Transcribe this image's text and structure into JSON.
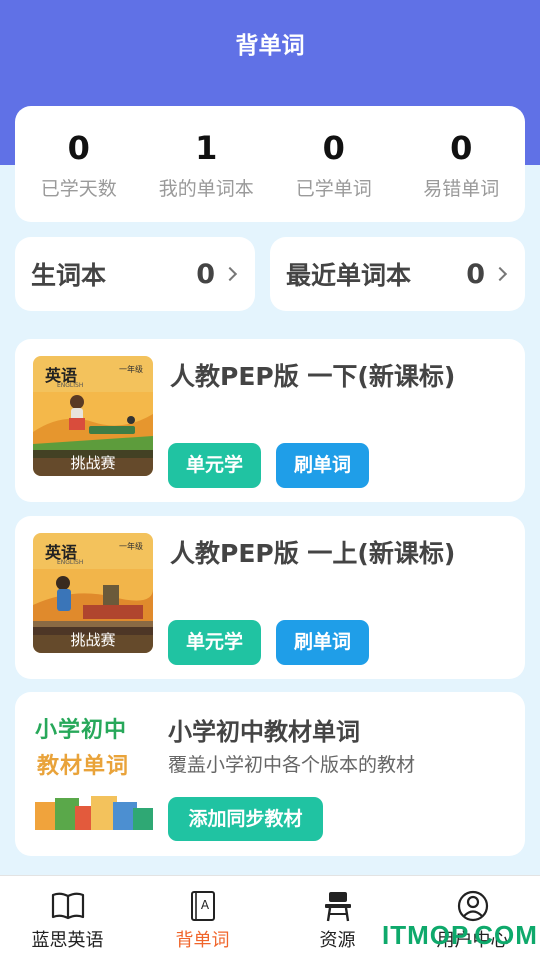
{
  "header": {
    "title": "背单词"
  },
  "stats": [
    {
      "value": "0",
      "label": "已学天数"
    },
    {
      "value": "1",
      "label": "我的单词本"
    },
    {
      "value": "0",
      "label": "已学单词"
    },
    {
      "value": "0",
      "label": "易错单词"
    }
  ],
  "quick": {
    "new_words": {
      "title": "生词本",
      "count": "0"
    },
    "recent": {
      "title": "最近单词本",
      "count": "0"
    }
  },
  "books": [
    {
      "title": "人教PEP版 一下(新课标)",
      "cover_title": "英语",
      "cover_sub": "ENGLISH",
      "cover_grade": "一年级",
      "badge": "挑战赛",
      "unit_btn": "单元学",
      "brush_btn": "刷单词"
    },
    {
      "title": "人教PEP版 一上(新课标)",
      "cover_title": "英语",
      "cover_sub": "ENGLISH",
      "cover_grade": "一年级",
      "badge": "挑战赛",
      "unit_btn": "单元学",
      "brush_btn": "刷单词"
    }
  ],
  "sync": {
    "cover_line1": "小学初中",
    "cover_line2": "教材单词",
    "title": "小学初中教材单词",
    "desc": "覆盖小学初中各个版本的教材",
    "button": "添加同步教材"
  },
  "tabs": [
    {
      "label": "蓝思英语",
      "icon": "book-open-icon"
    },
    {
      "label": "背单词",
      "icon": "word-book-icon",
      "active": true
    },
    {
      "label": "资源",
      "icon": "desk-chair-icon"
    },
    {
      "label": "用户中心",
      "icon": "user-circle-icon"
    }
  ],
  "watermark": "ITMOP.COM",
  "colors": {
    "header": "#6071e6",
    "teal_button": "#20c3a2",
    "blue_button": "#1f9ee8",
    "active_tab": "#f0652b",
    "page_bg": "#e4f4fd"
  }
}
